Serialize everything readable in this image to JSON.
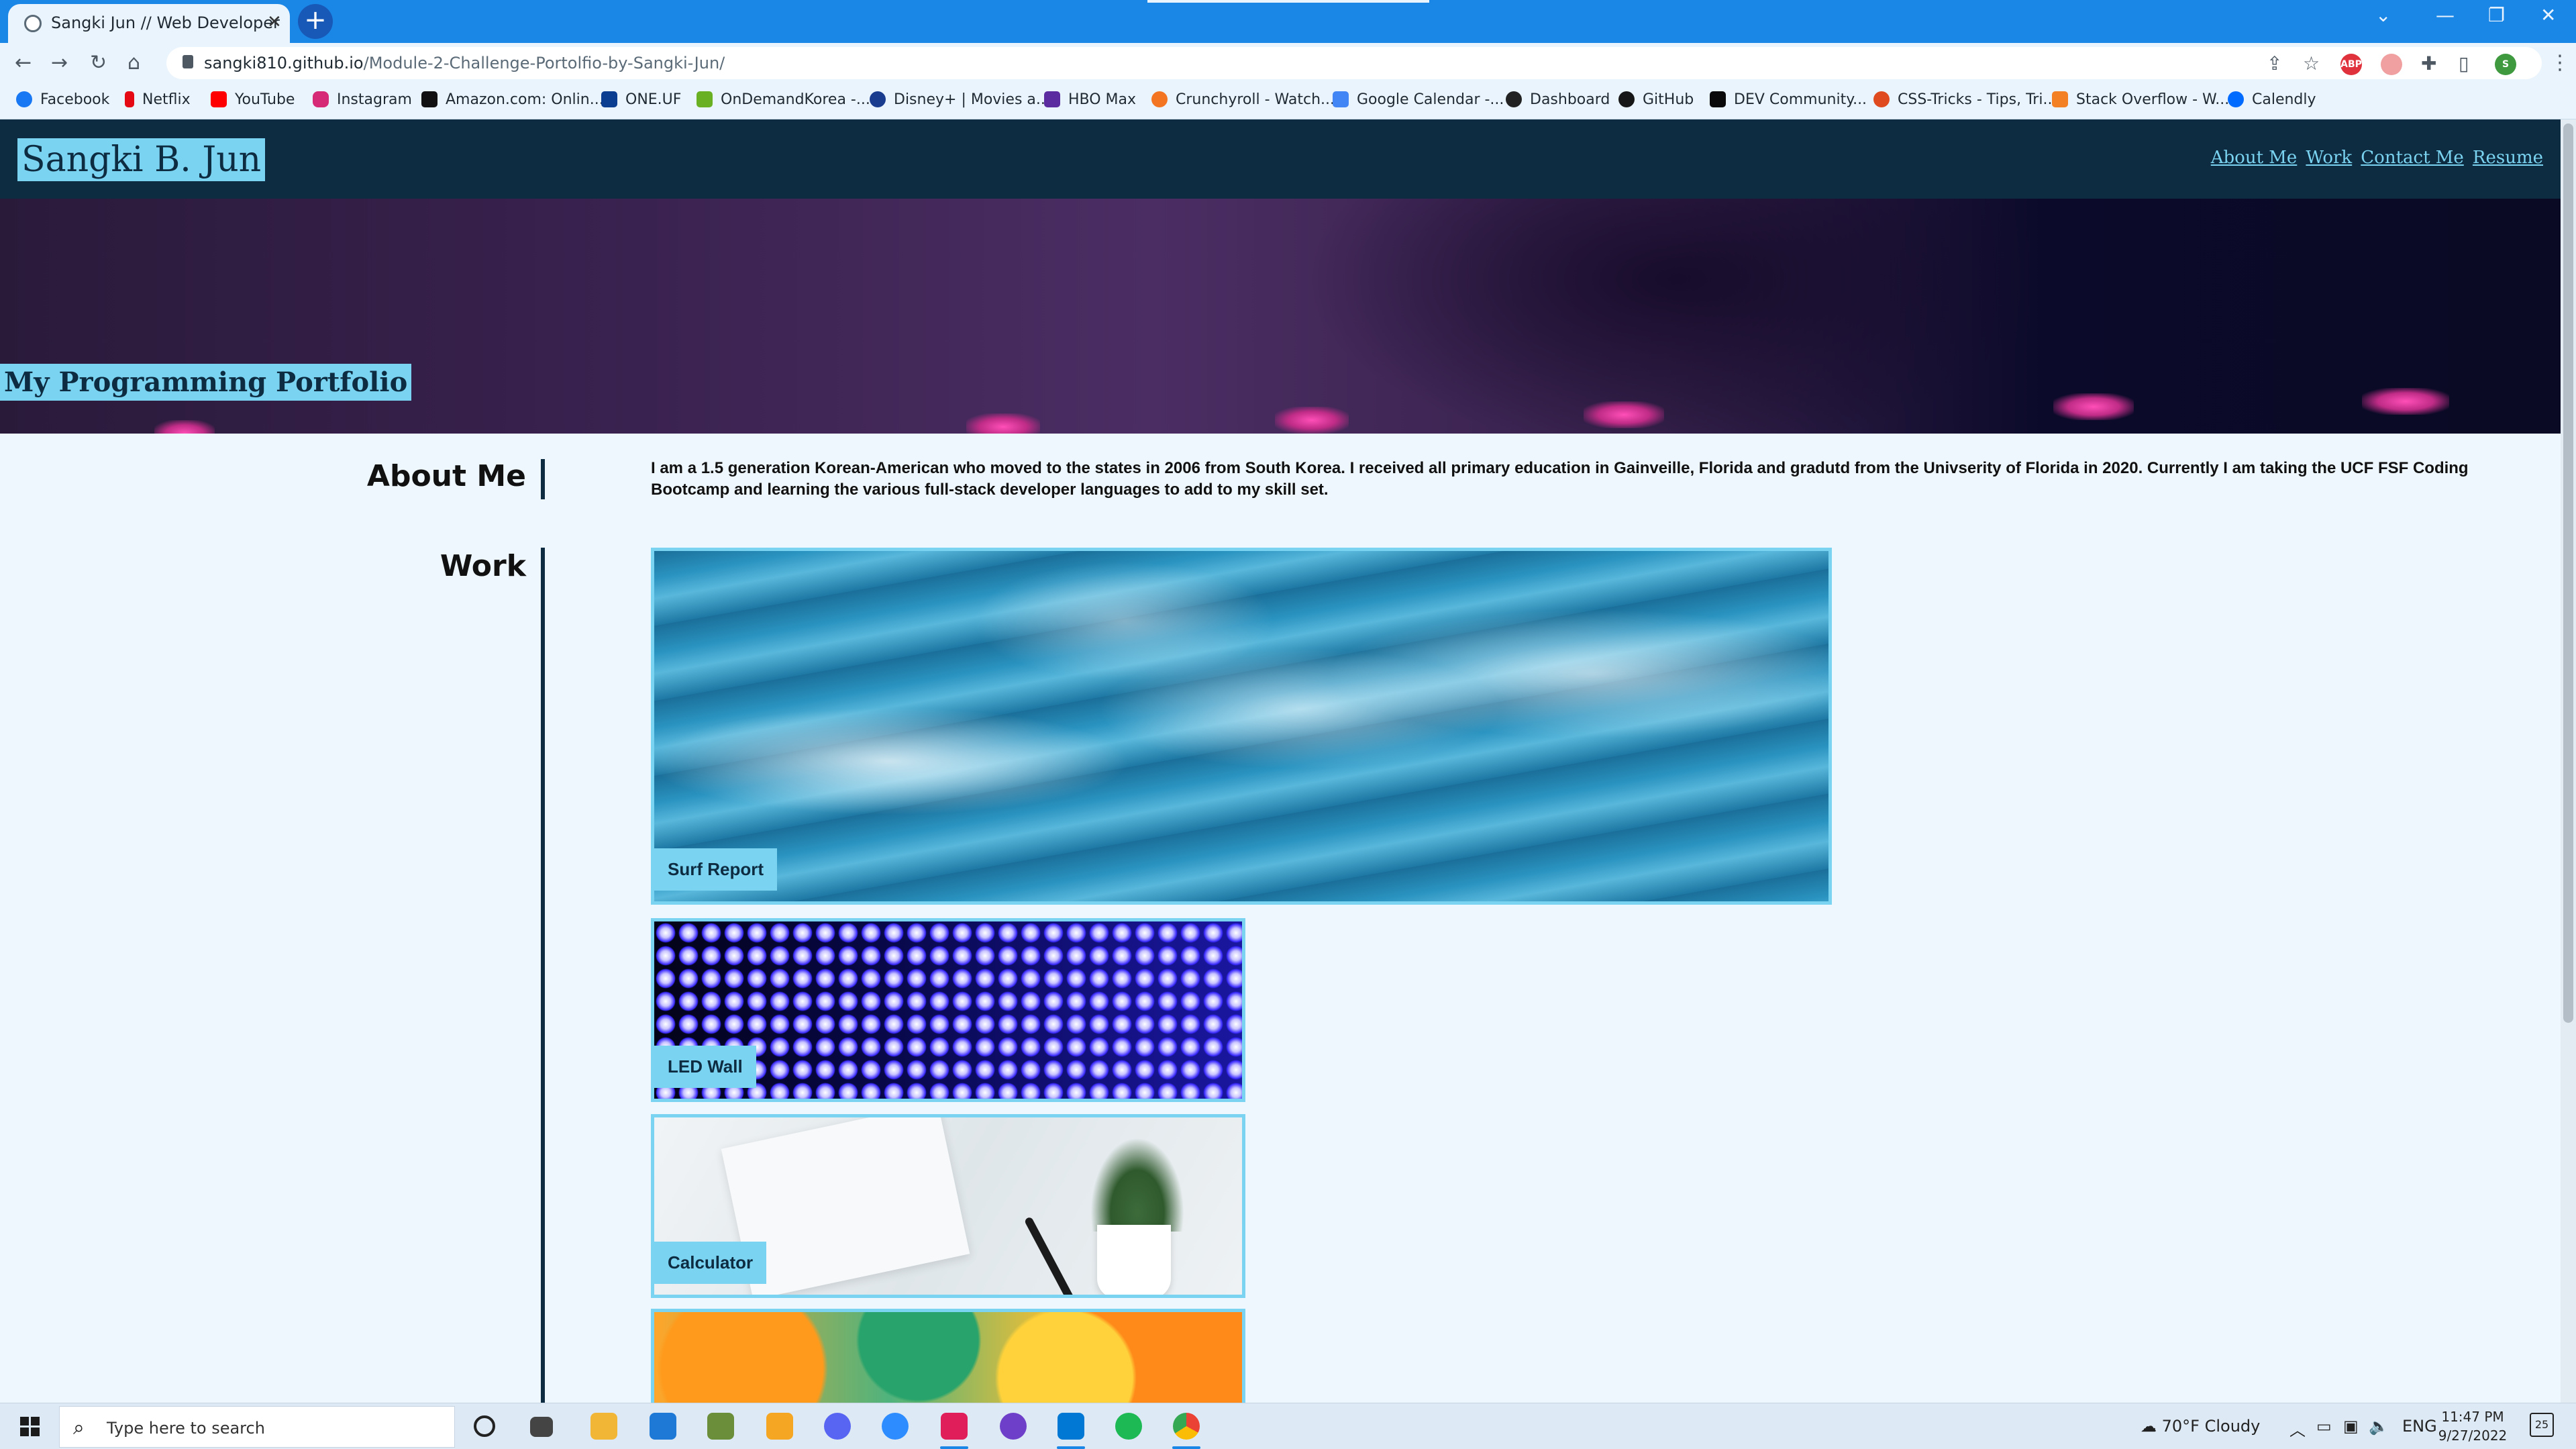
{
  "browser": {
    "tab_title": "Sangki Jun // Web Developer",
    "new_tab_symbol": "+",
    "tab_close_symbol": "✕",
    "url_host": "sangki810.github.io",
    "url_path": "/Module-2-Challenge-Portolfio-by-Sangki-Jun/",
    "profile_initial": "S",
    "adblock_label": "ABP"
  },
  "bookmarks": [
    {
      "label": "Facebook",
      "icon": "facebook-icon",
      "color": "#1877f2"
    },
    {
      "label": "Netflix",
      "icon": "netflix-icon",
      "color": "#e50914"
    },
    {
      "label": "YouTube",
      "icon": "youtube-icon",
      "color": "#ff0000"
    },
    {
      "label": "Instagram",
      "icon": "instagram-icon",
      "color": "#d62976"
    },
    {
      "label": "Amazon.com: Onlin...",
      "icon": "amazon-icon",
      "color": "#111111"
    },
    {
      "label": "ONE.UF",
      "icon": "uf-icon",
      "color": "#0b3d91"
    },
    {
      "label": "OnDemandKorea -...",
      "icon": "ondemandkorea-icon",
      "color": "#6ab023"
    },
    {
      "label": "Disney+ | Movies a...",
      "icon": "disney-icon",
      "color": "#1a3c8f"
    },
    {
      "label": "HBO Max",
      "icon": "hbomax-icon",
      "color": "#5b2ca0"
    },
    {
      "label": "Crunchyroll - Watch...",
      "icon": "crunchyroll-icon",
      "color": "#f47521"
    },
    {
      "label": "Google Calendar -...",
      "icon": "calendar-icon",
      "color": "#4285f4"
    },
    {
      "label": "Dashboard",
      "icon": "dashboard-icon",
      "color": "#222222"
    },
    {
      "label": "GitHub",
      "icon": "github-icon",
      "color": "#181717"
    },
    {
      "label": "DEV Community...",
      "icon": "dev-icon",
      "color": "#0a0a0a"
    },
    {
      "label": "CSS-Tricks - Tips, Tri...",
      "icon": "csstricks-icon",
      "color": "#e04a1f"
    },
    {
      "label": "Stack Overflow - W...",
      "icon": "stackoverflow-icon",
      "color": "#f48024"
    },
    {
      "label": "Calendly",
      "icon": "calendly-icon",
      "color": "#006bff"
    }
  ],
  "site": {
    "name": "Sangki B. Jun",
    "nav": [
      "About Me",
      "Work",
      "Contact Me",
      "Resume"
    ],
    "hero_title": "My Programming Portfolio",
    "about_heading": "About Me",
    "about_text": "I am a 1.5 generation Korean-American who moved to the states in 2006 from South Korea. I received all primary education in Gainveille, Florida and gradutd from the Univserity of Florida in 2020. Currently I am taking the UCF FSF Coding Bootcamp and learning the various full-stack developer languages to add to my skill set.",
    "work_heading": "Work",
    "projects": [
      {
        "label": "Surf Report",
        "image": "ocean-waves-image"
      },
      {
        "label": "LED Wall",
        "image": "led-lights-image"
      },
      {
        "label": "Calculator",
        "image": "desk-plant-image"
      },
      {
        "label": "",
        "image": "puzzle-pieces-image"
      }
    ],
    "colors": {
      "header_bg": "#0d2c42",
      "accent": "#7ad3f0",
      "page_bg": "#eef7fd"
    }
  },
  "taskbar": {
    "search_placeholder": "Type here to search",
    "weather": "70°F  Cloudy",
    "language": "ENG",
    "time": "11:47 PM",
    "date": "9/27/2022",
    "notification_count": "25"
  }
}
